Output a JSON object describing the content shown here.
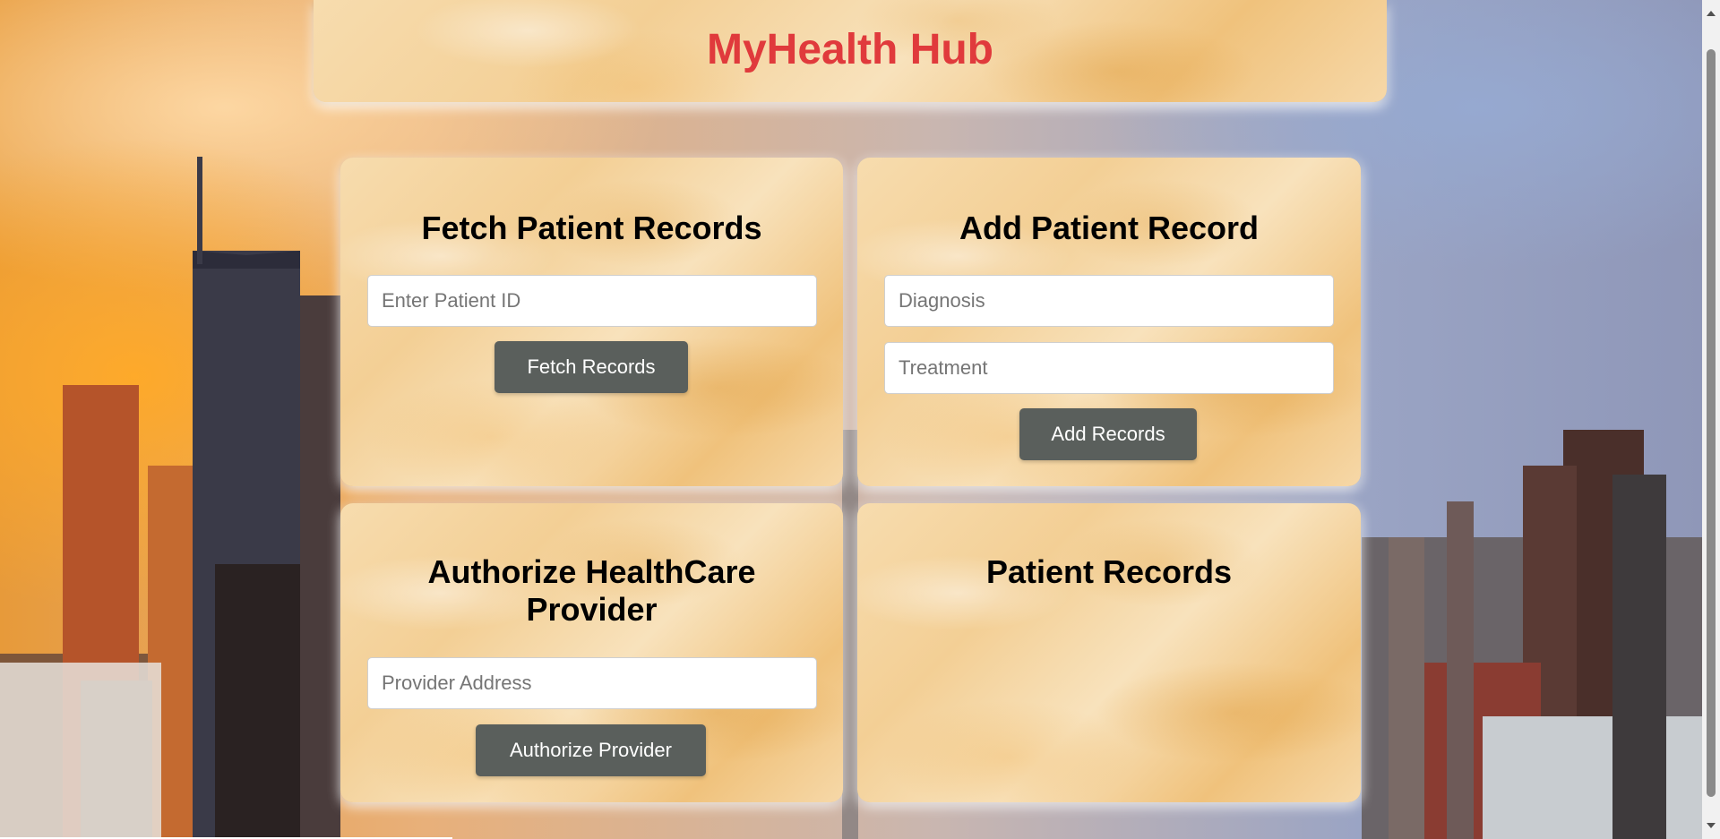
{
  "app": {
    "title": "MyHealth Hub",
    "title_color": "#e03a3c"
  },
  "fetch_card": {
    "title": "Fetch Patient Records",
    "patient_id_placeholder": "Enter Patient ID",
    "patient_id_value": "",
    "button_label": "Fetch Records"
  },
  "add_card": {
    "title": "Add Patient Record",
    "diagnosis_placeholder": "Diagnosis",
    "diagnosis_value": "",
    "treatment_placeholder": "Treatment",
    "treatment_value": "",
    "button_label": "Add Records"
  },
  "authorize_card": {
    "title_line1": "Authorize HealthCare",
    "title_line2": "Provider",
    "provider_placeholder": "Provider Address",
    "provider_value": "",
    "button_label": "Authorize Provider"
  },
  "records_card": {
    "title": "Patient Records"
  },
  "colors": {
    "button_bg": "#5a5f5c",
    "card_bg": "#f6d8a8"
  }
}
